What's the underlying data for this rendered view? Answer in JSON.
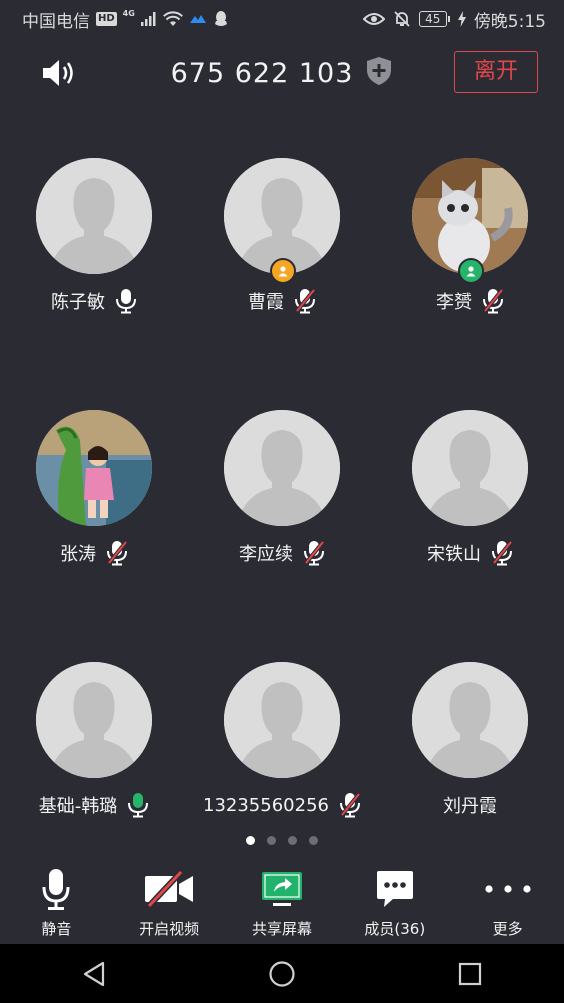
{
  "status_bar": {
    "carrier": "中国电信",
    "hd": "HD",
    "network": "4G",
    "battery": "45",
    "time": "傍晚5:15"
  },
  "header": {
    "meeting_id": "675 622 103",
    "leave_label": "离开"
  },
  "participants": [
    {
      "name": "陈子敏",
      "mic": "on",
      "avatar": "placeholder",
      "badge": "none"
    },
    {
      "name": "曹霞",
      "mic": "muted",
      "avatar": "placeholder",
      "badge": "host"
    },
    {
      "name": "李赟",
      "mic": "muted",
      "avatar": "cat-photo",
      "badge": "cohost"
    },
    {
      "name": "张涛",
      "mic": "muted",
      "avatar": "child-photo",
      "badge": "none"
    },
    {
      "name": "李应续",
      "mic": "muted",
      "avatar": "placeholder",
      "badge": "none"
    },
    {
      "name": "宋铁山",
      "mic": "muted",
      "avatar": "placeholder",
      "badge": "none"
    },
    {
      "name": "基础-韩璐",
      "mic": "active",
      "avatar": "placeholder",
      "badge": "none"
    },
    {
      "name": "13235560256",
      "mic": "muted",
      "avatar": "placeholder",
      "badge": "none"
    },
    {
      "name": "刘丹霞",
      "mic": "none",
      "avatar": "placeholder",
      "badge": "none"
    }
  ],
  "pagination": {
    "pages": 4,
    "current": 1
  },
  "toolbar": {
    "mute_label": "静音",
    "video_label": "开启视频",
    "share_label": "共享屏幕",
    "members_label": "成员(36)",
    "more_label": "更多"
  },
  "colors": {
    "background": "#2b2c33",
    "leave_red": "#e0464a",
    "muted_red": "#e0464a",
    "active_green": "#25b46a",
    "host_orange": "#f5a623",
    "share_green": "#21b26b"
  }
}
